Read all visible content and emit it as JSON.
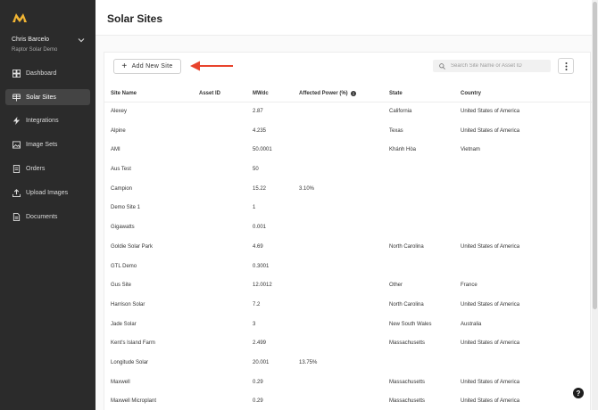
{
  "app": {
    "brand_color": "#f2b533",
    "accent_arrow": "#e8432c"
  },
  "user": {
    "name": "Chris Barcelo",
    "org": "Raptor Solar Demo"
  },
  "nav": [
    {
      "label": "Dashboard",
      "icon": "dashboard-icon",
      "active": false
    },
    {
      "label": "Solar Sites",
      "icon": "solar-panel-icon",
      "active": true
    },
    {
      "label": "Integrations",
      "icon": "lightning-icon",
      "active": false
    },
    {
      "label": "Image Sets",
      "icon": "image-icon",
      "active": false
    },
    {
      "label": "Orders",
      "icon": "orders-icon",
      "active": false
    },
    {
      "label": "Upload Images",
      "icon": "upload-icon",
      "active": false
    },
    {
      "label": "Documents",
      "icon": "document-icon",
      "active": false
    }
  ],
  "page": {
    "title": "Solar Sites"
  },
  "toolbar": {
    "add_label": "Add New Site",
    "search_placeholder": "Search Site Name or Asset ID"
  },
  "table": {
    "headers": {
      "name": "Site Name",
      "asset": "Asset ID",
      "mw": "MWdc",
      "affected": "Affected Power (%)",
      "state": "State",
      "country": "Country"
    },
    "rows": [
      {
        "name": "Alexey",
        "asset": "",
        "mw": "2.87",
        "affected": "",
        "state": "California",
        "country": "United States of America"
      },
      {
        "name": "Alpine",
        "asset": "",
        "mw": "4.235",
        "affected": "",
        "state": "Texas",
        "country": "United States of America"
      },
      {
        "name": "AMI",
        "asset": "",
        "mw": "50.0001",
        "affected": "",
        "state": "Khánh Hòa",
        "country": "Vietnam"
      },
      {
        "name": "Aus Test",
        "asset": "",
        "mw": "50",
        "affected": "",
        "state": "",
        "country": ""
      },
      {
        "name": "Campion",
        "asset": "",
        "mw": "15.22",
        "affected": "3.10%",
        "state": "",
        "country": ""
      },
      {
        "name": "Demo Site 1",
        "asset": "",
        "mw": "1",
        "affected": "",
        "state": "",
        "country": ""
      },
      {
        "name": "Gigawatts",
        "asset": "",
        "mw": "0.001",
        "affected": "",
        "state": "",
        "country": ""
      },
      {
        "name": "Goldie Solar Park",
        "asset": "",
        "mw": "4.69",
        "affected": "",
        "state": "North Carolina",
        "country": "United States of America"
      },
      {
        "name": "GTL Demo",
        "asset": "",
        "mw": "0.3001",
        "affected": "",
        "state": "",
        "country": ""
      },
      {
        "name": "Gus Site",
        "asset": "",
        "mw": "12.0012",
        "affected": "",
        "state": "Other",
        "country": "France"
      },
      {
        "name": "Harrison Solar",
        "asset": "",
        "mw": "7.2",
        "affected": "",
        "state": "North Carolina",
        "country": "United States of America"
      },
      {
        "name": "Jade Solar",
        "asset": "",
        "mw": "3",
        "affected": "",
        "state": "New South Wales",
        "country": "Australia"
      },
      {
        "name": "Kent's Island Farm",
        "asset": "",
        "mw": "2.499",
        "affected": "",
        "state": "Massachusetts",
        "country": "United States of America"
      },
      {
        "name": "Longitude Solar",
        "asset": "",
        "mw": "20.001",
        "affected": "13.75%",
        "state": "",
        "country": ""
      },
      {
        "name": "Maxwell",
        "asset": "",
        "mw": "0.29",
        "affected": "",
        "state": "Massachusetts",
        "country": "United States of America"
      },
      {
        "name": "Maxwell Microplant",
        "asset": "",
        "mw": "0.29",
        "affected": "",
        "state": "Massachusetts",
        "country": "United States of America"
      }
    ]
  },
  "help": {
    "label": "?"
  }
}
